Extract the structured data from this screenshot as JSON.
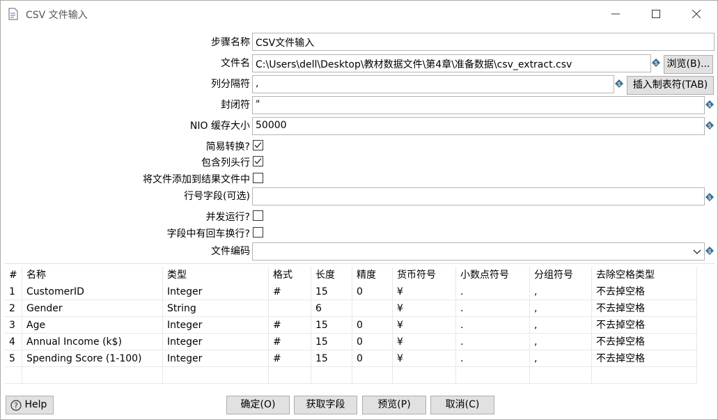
{
  "window": {
    "title": "CSV 文件输入",
    "icon": "document-icon"
  },
  "form": {
    "step_name_label": "步骤名称",
    "step_name_value": "CSV文件输入",
    "filename_label": "文件名",
    "filename_value": "C:\\Users\\dell\\Desktop\\教材数据文件\\第4章\\准备数据\\csv_extract.csv",
    "browse_button": "浏览(B)...",
    "delimiter_label": "列分隔符",
    "delimiter_value": ",",
    "insert_tab_button": "插入制表符(TAB)",
    "enclosure_label": "封闭符",
    "enclosure_value": "\"",
    "nio_label": "NIO 缓存大小",
    "nio_value": "50000",
    "lazy_label": "简易转换?",
    "lazy_checked": true,
    "header_label": "包含列头行",
    "header_checked": true,
    "add_result_label": "将文件添加到结果文件中",
    "add_result_checked": false,
    "rownum_label": "行号字段(可选)",
    "rownum_value": "",
    "parallel_label": "并发运行?",
    "parallel_checked": false,
    "newline_label": "字段中有回车换行?",
    "newline_checked": false,
    "encoding_label": "文件编码",
    "encoding_value": ""
  },
  "table": {
    "headers": [
      "#",
      "名称",
      "类型",
      "格式",
      "长度",
      "精度",
      "货币符号",
      "小数点符号",
      "分组符号",
      "去除空格类型"
    ],
    "rows": [
      [
        "1",
        "CustomerID",
        "Integer",
        "#",
        "15",
        "0",
        "¥",
        ".",
        ",",
        "不去掉空格"
      ],
      [
        "2",
        "Gender",
        "String",
        "",
        "6",
        "",
        "¥",
        ".",
        ",",
        "不去掉空格"
      ],
      [
        "3",
        "Age",
        "Integer",
        "#",
        "15",
        "0",
        "¥",
        ".",
        ",",
        "不去掉空格"
      ],
      [
        "4",
        "Annual Income (k$)",
        "Integer",
        "#",
        "15",
        "0",
        "¥",
        ".",
        ",",
        "不去掉空格"
      ],
      [
        "5",
        "Spending Score (1-100)",
        "Integer",
        "#",
        "15",
        "0",
        "¥",
        ".",
        ",",
        "不去掉空格"
      ]
    ]
  },
  "buttons": {
    "help": "Help",
    "ok": "确定(O)",
    "get_fields": "获取字段",
    "preview": "预览(P)",
    "cancel": "取消(C)"
  },
  "colors": {
    "variable_icon": "#3b6e8f",
    "button_bg": "#e1e1e1"
  }
}
